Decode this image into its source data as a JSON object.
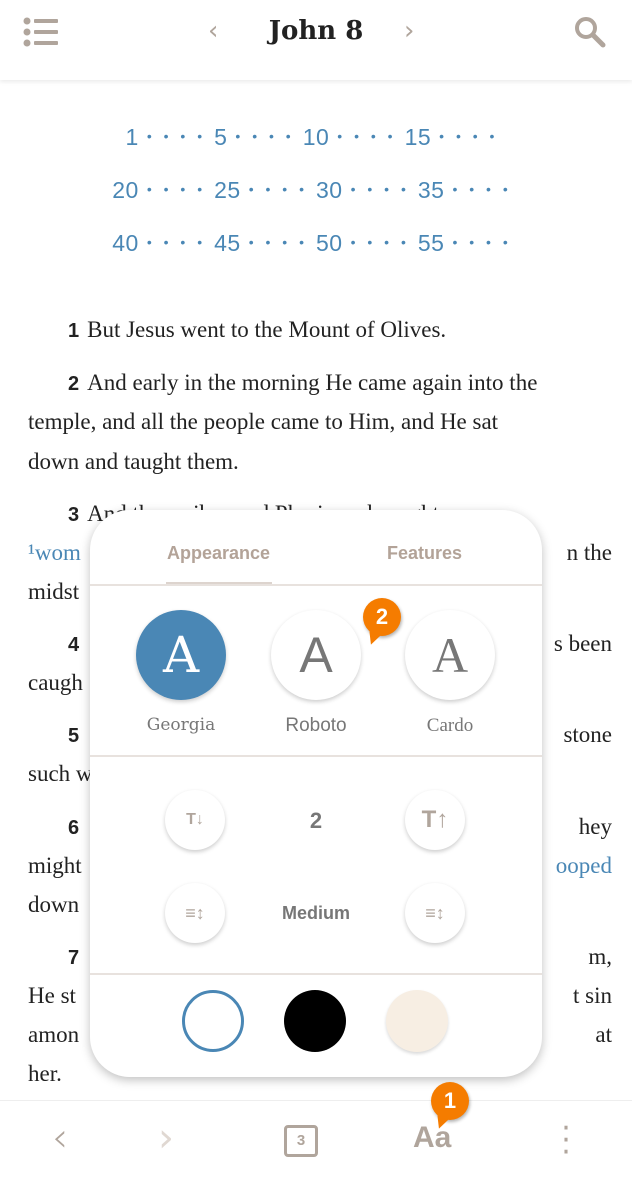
{
  "header": {
    "title": "John 8",
    "menu_icon": "list-icon",
    "prev_icon": "chevron-left-icon",
    "next_icon": "chevron-right-icon",
    "search_icon": "search-icon"
  },
  "verse_nav": {
    "rows": [
      [
        "1",
        "5",
        "10",
        "15"
      ],
      [
        "20",
        "25",
        "30",
        "35"
      ],
      [
        "40",
        "45",
        "50",
        "55"
      ]
    ],
    "dots": "• • • •"
  },
  "text_lines": [
    {
      "num": "1",
      "left": "But Jesus went to the Mount of Olives.",
      "right": ""
    },
    {
      "num": "2",
      "left": "And early in the morning He came again into the",
      "right": ""
    },
    {
      "num": "",
      "left": "temple, and all the people came to Him, and He sat",
      "right": ""
    },
    {
      "num": "",
      "left": "down and taught them.",
      "right": ""
    },
    {
      "num": "3",
      "left": "And the scribes and Pharisees brought a",
      "right": ""
    },
    {
      "num": "",
      "left": "¹wom",
      "right": "n the",
      "left_blue": true
    },
    {
      "num": "",
      "left": "midst",
      "right": ""
    },
    {
      "num": "4",
      "left": "",
      "right": "s been"
    },
    {
      "num": "",
      "left": "caugh",
      "right": ""
    },
    {
      "num": "5",
      "left": "",
      "right": "stone"
    },
    {
      "num": "",
      "left": "such w",
      "right": ""
    },
    {
      "num": "6",
      "left": "",
      "right": "hey"
    },
    {
      "num": "",
      "left": "might",
      "right": "ooped",
      "right_blue": true
    },
    {
      "num": "",
      "left": "down",
      "right": ""
    },
    {
      "num": "7",
      "left": "",
      "right": "m,"
    },
    {
      "num": "",
      "left": "He st",
      "right": "t sin"
    },
    {
      "num": "",
      "left": "amon",
      "right": "at"
    },
    {
      "num": "",
      "left": "her.",
      "right": ""
    }
  ],
  "popup": {
    "tabs": [
      {
        "label": "Appearance",
        "active": true
      },
      {
        "label": "Features",
        "active": false
      }
    ],
    "fonts": [
      {
        "glyph": "A",
        "label": "Georgia",
        "selected": true
      },
      {
        "glyph": "A",
        "label": "Roboto",
        "selected": false
      },
      {
        "glyph": "A",
        "label": "Cardo",
        "selected": false
      }
    ],
    "font_size": {
      "value": "2",
      "decrease_icon": "text-size-decrease-icon",
      "increase_icon": "text-size-increase-icon",
      "dec_glyph": "T↓",
      "inc_glyph": "T↑"
    },
    "line_spacing": {
      "value": "Medium",
      "decrease_icon": "line-spacing-decrease-icon",
      "increase_icon": "line-spacing-increase-icon"
    },
    "themes": [
      {
        "name": "white",
        "color": "#ffffff",
        "selected": true
      },
      {
        "name": "black",
        "color": "#000000",
        "selected": false
      },
      {
        "name": "sepia",
        "color": "#f7eee3",
        "selected": false
      }
    ],
    "badge": "2"
  },
  "footer": {
    "back_icon": "chevron-left-icon",
    "forward_icon": "chevron-right-icon",
    "chapter_box": "3",
    "text_settings": "Aa",
    "more_icon": "more-vertical-icon",
    "badge": "1"
  },
  "colors": {
    "accent": "#4a87b5",
    "icon": "#b0a59c",
    "badge": "#f57c00"
  }
}
